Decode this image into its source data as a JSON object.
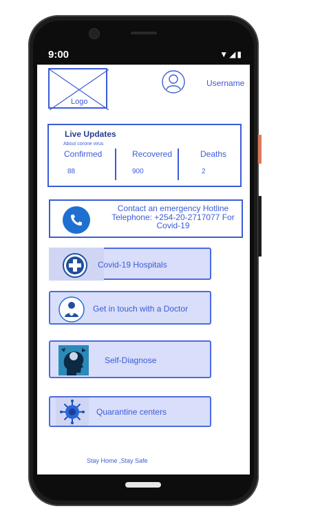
{
  "status": {
    "time": "9:00",
    "icons": "▼◢▮"
  },
  "header": {
    "logo_label": "Logo",
    "username": "Username"
  },
  "live_updates": {
    "title": "Live Updates",
    "subtitle": "About corone virus",
    "columns": [
      {
        "label": "Confirmed",
        "value": "88"
      },
      {
        "label": "Recovered",
        "value": "900"
      },
      {
        "label": "Deaths",
        "value": "2"
      }
    ]
  },
  "hotline": {
    "text": "Contact an emergency Hotline Telephone: +254-20-2717077 For Covid-19"
  },
  "menu": [
    {
      "label": "Covid-19 Hospitals",
      "icon": "hospital-cross-icon"
    },
    {
      "label": "Get in touch with a Doctor",
      "icon": "doctor-icon"
    },
    {
      "label": "Self-Diagnose",
      "icon": "head-diagnose-icon"
    },
    {
      "label": "Quarantine centers",
      "icon": "virus-icon"
    }
  ],
  "footer": {
    "text": "Stay Home ,Stay Safe"
  },
  "colors": {
    "accent": "#3b5bd6",
    "card_bg": "#d9defa",
    "phone_button": "#1f6fd1"
  }
}
